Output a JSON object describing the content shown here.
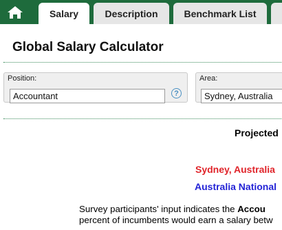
{
  "tabs": [
    {
      "label": "Salary",
      "active": true
    },
    {
      "label": "Description",
      "active": false
    },
    {
      "label": "Benchmark List",
      "active": false
    }
  ],
  "page_title": "Global Salary Calculator",
  "position_field": {
    "label": "Position:",
    "value": "Accountant",
    "help_glyph": "?"
  },
  "area_field": {
    "label": "Area:",
    "value": "Sydney, Australia"
  },
  "results": {
    "projected_heading": "Projected",
    "city_line": "Sydney, Australia",
    "national_line": "Australia National"
  },
  "survey": {
    "line1_prefix": "Survey participants' input indicates the ",
    "line1_bold": "Accou",
    "line2": "percent of incumbents would earn a salary betw"
  },
  "colors": {
    "topbar": "#1e6b3c",
    "city": "#e0242a",
    "national": "#2323d6",
    "help": "#4a90c2"
  },
  "icons": {
    "home": "home-icon",
    "help": "help-icon"
  }
}
